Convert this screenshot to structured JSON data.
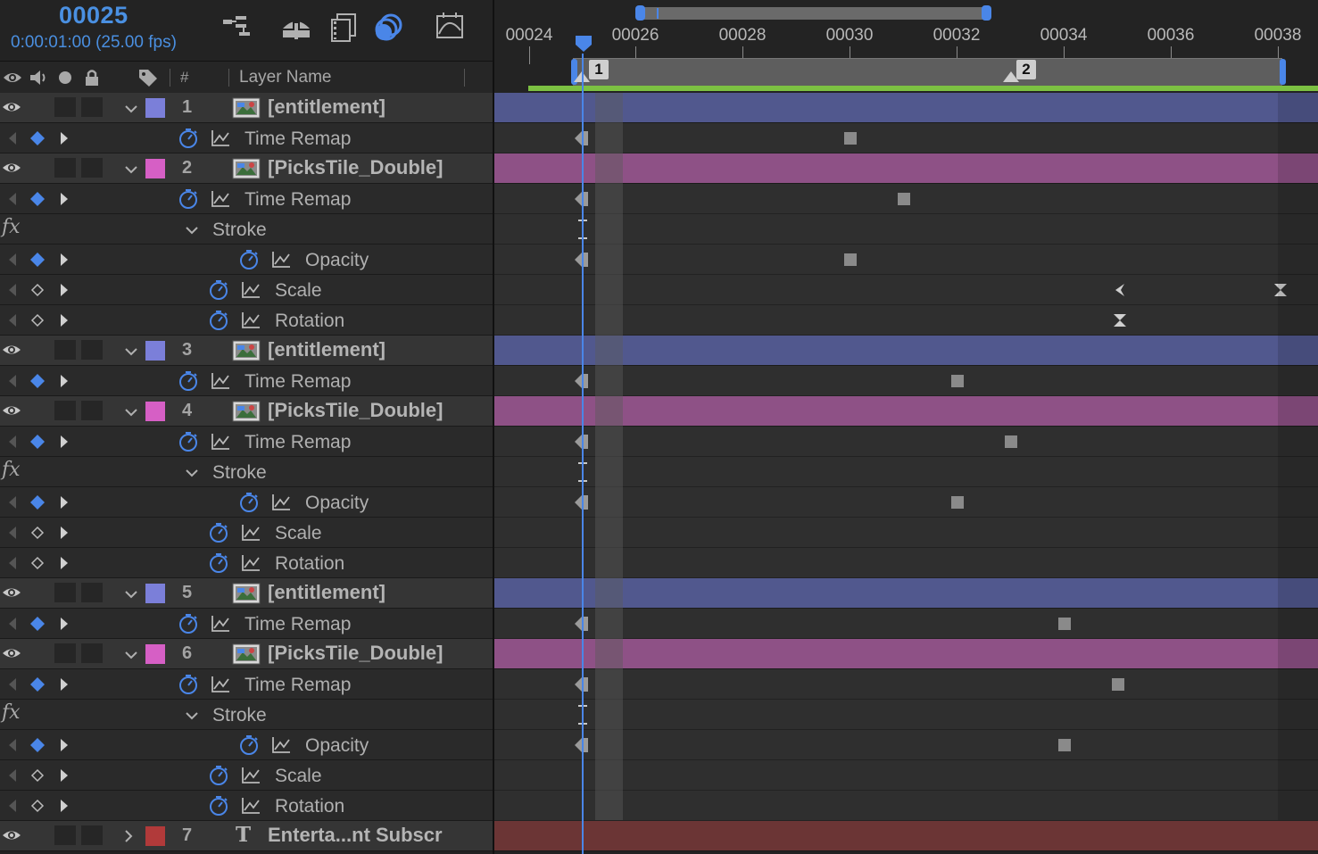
{
  "header": {
    "timecode": "00025",
    "timecode_sub": "0:00:01:00 (25.00 fps)",
    "icons": [
      "composition-flowchart-icon",
      "draft-3d-icon",
      "frame-blending-icon",
      "motion-blur-icon",
      "graph-editor-icon"
    ]
  },
  "columns": {
    "hash": "#",
    "layer_name": "Layer Name",
    "icons": [
      "eye-icon",
      "audio-icon",
      "solo-icon",
      "lock-icon",
      "label-icon"
    ]
  },
  "ruler": {
    "labels": [
      "00024",
      "00026",
      "00028",
      "00030",
      "00032",
      "00034",
      "00036",
      "00038"
    ],
    "markers": [
      "1",
      "2"
    ]
  },
  "colors": {
    "accent": "#4a86e8",
    "work_area": "#7cc142",
    "label_blue": "#7b7fd9",
    "label_pink": "#d65fc5",
    "label_red": "#b13a3a",
    "bar_blue": "#51588e",
    "bar_pink": "#8e5186",
    "bar_red": "#6b3535"
  },
  "rows": [
    {
      "type": "layer",
      "num": "1",
      "name": "[entitlement]",
      "color": "blue"
    },
    {
      "type": "prop",
      "name": "Time Remap",
      "keyed": true
    },
    {
      "type": "layer",
      "num": "2",
      "name": "[PicksTile_Double]",
      "color": "pink"
    },
    {
      "type": "prop",
      "name": "Time Remap",
      "keyed": true
    },
    {
      "type": "effect",
      "name": "Stroke"
    },
    {
      "type": "prop",
      "name": "Opacity",
      "keyed": true
    },
    {
      "type": "prop",
      "name": "Scale",
      "keyed": false
    },
    {
      "type": "prop",
      "name": "Rotation",
      "keyed": false
    },
    {
      "type": "layer",
      "num": "3",
      "name": "[entitlement]",
      "color": "blue"
    },
    {
      "type": "prop",
      "name": "Time Remap",
      "keyed": true
    },
    {
      "type": "layer",
      "num": "4",
      "name": "[PicksTile_Double]",
      "color": "pink"
    },
    {
      "type": "prop",
      "name": "Time Remap",
      "keyed": true
    },
    {
      "type": "effect",
      "name": "Stroke"
    },
    {
      "type": "prop",
      "name": "Opacity",
      "keyed": true
    },
    {
      "type": "prop",
      "name": "Scale",
      "keyed": false
    },
    {
      "type": "prop",
      "name": "Rotation",
      "keyed": false
    },
    {
      "type": "layer",
      "num": "5",
      "name": "[entitlement]",
      "color": "blue"
    },
    {
      "type": "prop",
      "name": "Time Remap",
      "keyed": true
    },
    {
      "type": "layer",
      "num": "6",
      "name": "[PicksTile_Double]",
      "color": "pink"
    },
    {
      "type": "prop",
      "name": "Time Remap",
      "keyed": true
    },
    {
      "type": "effect",
      "name": "Stroke"
    },
    {
      "type": "prop",
      "name": "Opacity",
      "keyed": true
    },
    {
      "type": "prop",
      "name": "Scale",
      "keyed": false
    },
    {
      "type": "prop",
      "name": "Rotation",
      "keyed": false
    },
    {
      "type": "layer",
      "num": "7",
      "name": "Enterta...nt Subscr",
      "color": "red",
      "text_layer": true
    }
  ]
}
